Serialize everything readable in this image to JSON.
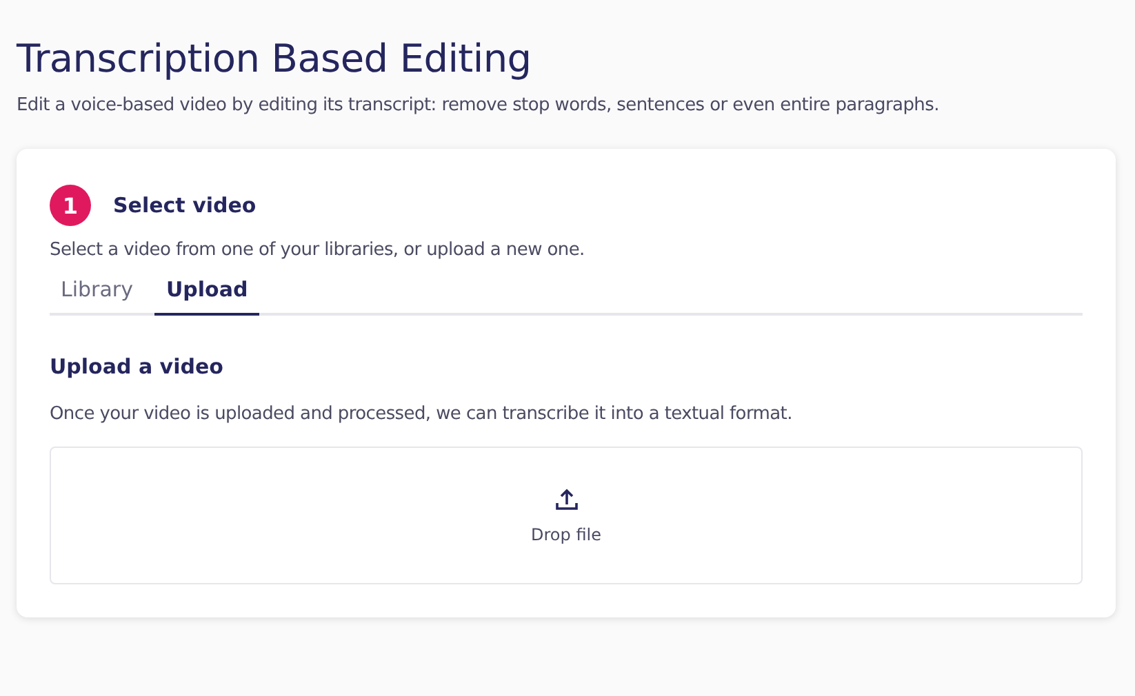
{
  "page": {
    "title": "Transcription Based Editing",
    "subtitle": "Edit a voice-based video by editing its transcript: remove stop words, sentences or even entire paragraphs."
  },
  "step": {
    "number": "1",
    "title": "Select video",
    "description": "Select a video from one of your libraries, or upload a new one."
  },
  "tabs": [
    {
      "label": "Library",
      "selected": false
    },
    {
      "label": "Upload",
      "selected": true
    }
  ],
  "upload": {
    "heading": "Upload a video",
    "description": "Once your video is uploaded and processed, we can transcribe it into a textual format.",
    "dropzone_label": "Drop file"
  }
}
